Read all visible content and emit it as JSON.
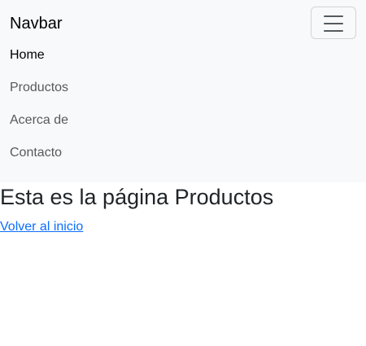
{
  "navbar": {
    "brand": "Navbar",
    "toggler_icon": "hamburger-icon",
    "items": [
      {
        "label": "Home",
        "active": true
      },
      {
        "label": "Productos",
        "active": false
      },
      {
        "label": "Acerca de",
        "active": false
      },
      {
        "label": "Contacto",
        "active": false
      }
    ]
  },
  "main": {
    "title": "Esta es la página Productos",
    "back_link": "Volver al inicio"
  },
  "colors": {
    "navbar_bg": "#f8f9fa",
    "link": "#0d6efd",
    "text": "#212529"
  }
}
